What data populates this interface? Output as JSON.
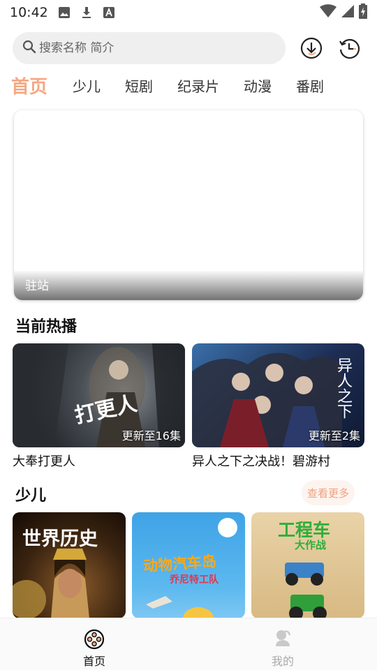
{
  "status": {
    "time": "10:42",
    "icons": [
      "image-icon",
      "download-icon",
      "text-icon"
    ],
    "right_icons": [
      "wifi-icon",
      "signal-icon",
      "battery-icon"
    ]
  },
  "search": {
    "placeholder": "搜索名称 简介"
  },
  "header_buttons": [
    "download-icon",
    "history-icon"
  ],
  "tabs": [
    {
      "label": "首页",
      "active": true
    },
    {
      "label": "少儿"
    },
    {
      "label": "短剧"
    },
    {
      "label": "纪录片"
    },
    {
      "label": "动漫"
    },
    {
      "label": "番剧"
    }
  ],
  "banner": {
    "label": "驻站"
  },
  "hot": {
    "title": "当前热播",
    "items": [
      {
        "name": "大奉打更人",
        "badge": "更新至16集",
        "poster_text": "打更人"
      },
      {
        "name": "异人之下之决战！碧游村",
        "badge": "更新至2集",
        "poster_text": "异人之下"
      }
    ]
  },
  "kids": {
    "title": "少儿",
    "more": "查看更多",
    "items": [
      {
        "poster_text": "世界历史"
      },
      {
        "poster_text": "动物汽车岛",
        "poster_sub": "乔尼特工队"
      },
      {
        "poster_text": "工程车",
        "poster_sub": "大作战"
      }
    ]
  },
  "nav": [
    {
      "label": "首页",
      "active": true,
      "icon": "film-reel-icon"
    },
    {
      "label": "我的",
      "icon": "profile-icon"
    }
  ],
  "colors": {
    "accent": "#f5a884",
    "more_bg": "#fdf4ef"
  }
}
